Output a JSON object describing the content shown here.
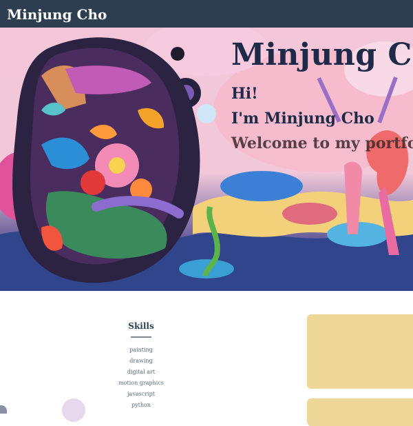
{
  "nav": {
    "brand": "Minjung Cho"
  },
  "hero": {
    "title": "Minjung Cho",
    "greeting": "Hi!",
    "intro": "I'm Minjung Cho",
    "welcome": "Welcome to my portfolio"
  },
  "skills": {
    "title": "Skills",
    "items": [
      "painting",
      "drawing",
      "digital art",
      "motion graphics",
      "javascript",
      "python"
    ]
  },
  "colors": {
    "nav_bg": "#2c3e50",
    "card_bg": "#efd79a",
    "text_dark": "#1f2a48"
  }
}
